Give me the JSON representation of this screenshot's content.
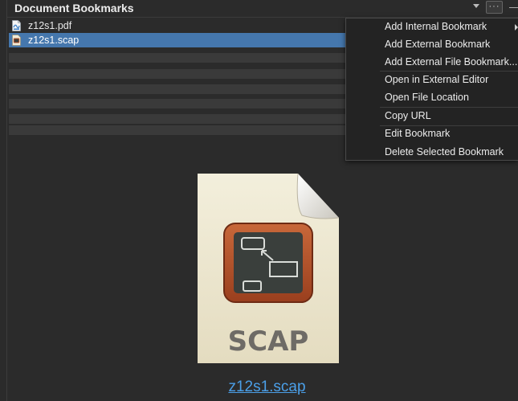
{
  "panel": {
    "title": "Document Bookmarks",
    "more_button": "···"
  },
  "bookmarks": [
    {
      "name": "z12s1.pdf",
      "icon": "pdf-file-icon",
      "selected": false
    },
    {
      "name": "z12s1.scap",
      "icon": "scap-file-icon",
      "selected": true
    }
  ],
  "context_menu": {
    "items": [
      {
        "label": "Add Internal Bookmark",
        "has_submenu": true
      },
      {
        "label": "Add External Bookmark"
      },
      {
        "label": "Add External File Bookmark..."
      },
      {
        "label": "Open in External Editor"
      },
      {
        "label": "Open File Location"
      },
      {
        "label": "Copy URL"
      },
      {
        "label": "Edit Bookmark"
      },
      {
        "label": "Delete Selected Bookmark"
      }
    ]
  },
  "preview": {
    "badge_text": "SCAP",
    "link_text": "z12s1.scap"
  },
  "colors": {
    "background": "#2b2b2b",
    "selection": "#4577ad",
    "menu_background": "#232323",
    "link": "#4b9fe8",
    "chalkboard_frame": "#b5532b",
    "chalkboard": "#3a3f3c"
  }
}
